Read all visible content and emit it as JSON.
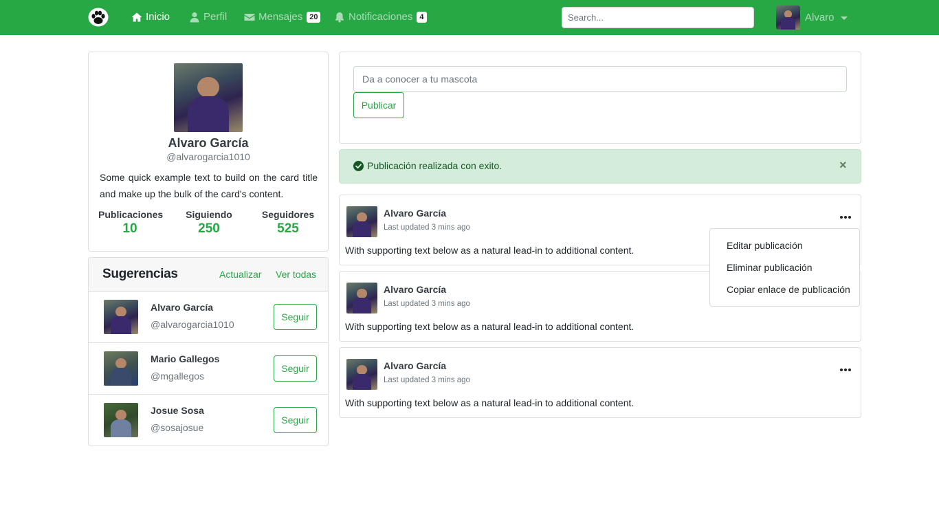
{
  "navbar": {
    "brand_icon": "paw-icon",
    "links": [
      {
        "label": "Inicio",
        "icon": "home-icon",
        "active": true
      },
      {
        "label": "Perfil",
        "icon": "user-icon"
      },
      {
        "label": "Mensajes",
        "icon": "envelope-icon",
        "badge": "20"
      },
      {
        "label": "Notificaciones",
        "icon": "bell-icon",
        "badge": "4"
      }
    ],
    "search_placeholder": "Search...",
    "user_name": "Alvaro"
  },
  "profile": {
    "name": "Alvaro García",
    "handle": "@alvarogarcia1010",
    "description": "Some quick example text to build on the card title and make up the bulk of the card's content.",
    "stats": [
      {
        "label": "Publicaciones",
        "value": "10"
      },
      {
        "label": "Siguiendo",
        "value": "250"
      },
      {
        "label": "Seguidores",
        "value": "525"
      }
    ]
  },
  "suggestions": {
    "title": "Sugerencias",
    "refresh_label": "Actualizar",
    "view_all_label": "Ver todas",
    "follow_label": "Seguir",
    "items": [
      {
        "name": "Alvaro García",
        "handle": "@alvarogarcia1010"
      },
      {
        "name": "Mario Gallegos",
        "handle": "@mgallegos"
      },
      {
        "name": "Josue Sosa",
        "handle": "@sosajosue"
      }
    ]
  },
  "composer": {
    "placeholder": "Da a conocer a tu mascota",
    "submit_label": "Publicar"
  },
  "alert": {
    "message": "Publicación realizada con exito.",
    "close": "×",
    "color": "#d4edda"
  },
  "posts": [
    {
      "author": "Alvaro García",
      "time": "Last updated 3 mins ago",
      "text": "With supporting text below as a natural lead-in to additional content."
    },
    {
      "author": "Alvaro García",
      "time": "Last updated 3 mins ago",
      "text": "With supporting text below as a natural lead-in to additional content."
    },
    {
      "author": "Alvaro García",
      "time": "Last updated 3 mins ago",
      "text": "With supporting text below as a natural lead-in to additional content."
    }
  ],
  "post_menu": {
    "items": [
      "Editar publicación",
      "Eliminar publicación",
      "Copiar enlace de publicación"
    ]
  },
  "colors": {
    "brand": "#28a745",
    "alert_text": "#155724"
  }
}
